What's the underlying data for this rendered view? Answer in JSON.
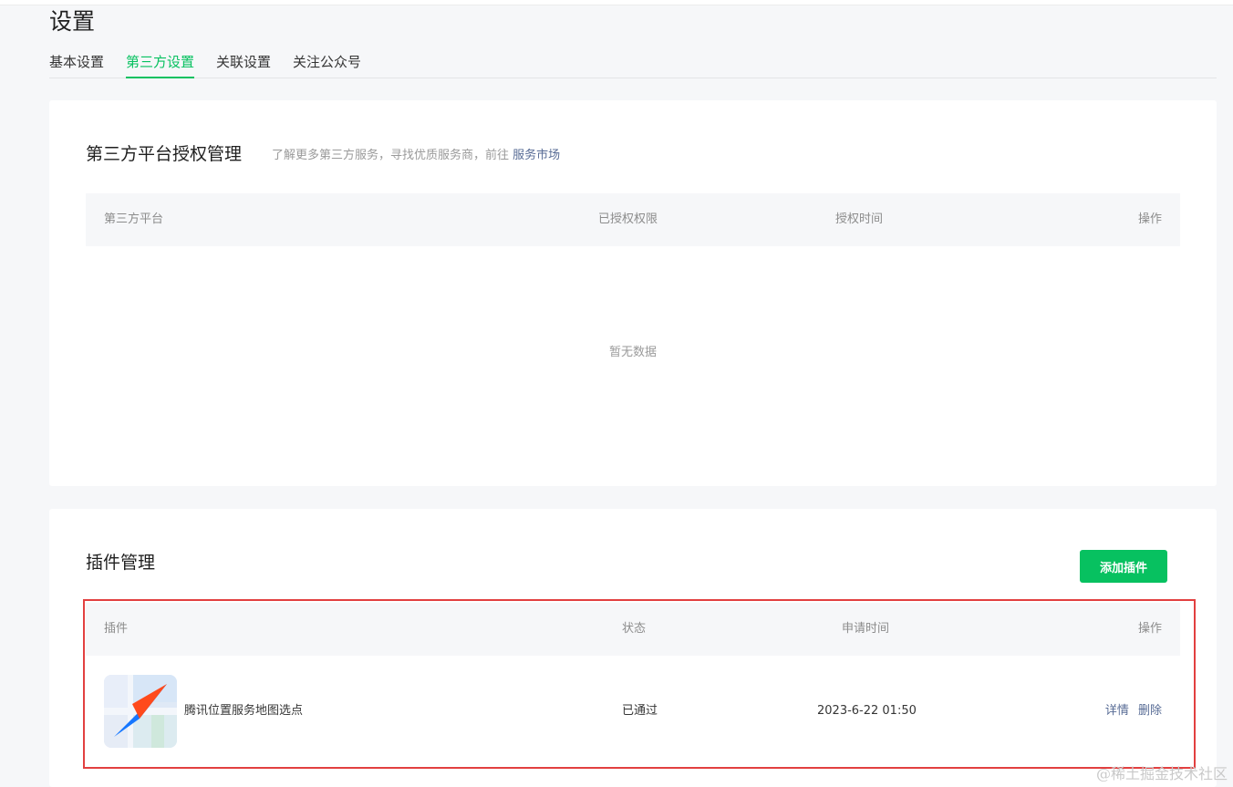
{
  "page": {
    "title": "设置"
  },
  "tabs": [
    {
      "label": "基本设置",
      "active": false
    },
    {
      "label": "第三方设置",
      "active": true
    },
    {
      "label": "关联设置",
      "active": false
    },
    {
      "label": "关注公众号",
      "active": false
    }
  ],
  "third_party": {
    "title": "第三方平台授权管理",
    "desc": "了解更多第三方服务，寻找优质服务商，前往",
    "market_link": "服务市场",
    "columns": [
      "第三方平台",
      "已授权权限",
      "授权时间",
      "操作"
    ],
    "empty_text": "暂无数据"
  },
  "plugins": {
    "title": "插件管理",
    "add_button": "添加插件",
    "columns": [
      "插件",
      "状态",
      "申请时间",
      "操作"
    ],
    "rows": [
      {
        "name": "腾讯位置服务地图选点",
        "status": "已通过",
        "apply_time": "2023-6-22 01:50",
        "op_detail": "详情",
        "op_delete": "删除",
        "icon": "map-compass-icon"
      }
    ]
  },
  "watermark": "@稀土掘金技术社区",
  "colors": {
    "accent": "#07c160",
    "link": "#576b95",
    "highlight": "#e24040"
  }
}
